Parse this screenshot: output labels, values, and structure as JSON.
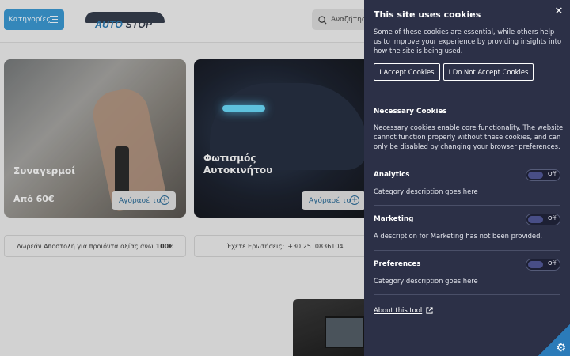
{
  "header": {
    "categories_label": "Κατηγορίες",
    "logo_text_a": "AUTO",
    "logo_text_b": "STOP",
    "search_placeholder": "Αναζήτηση"
  },
  "cards": [
    {
      "title": "Συναγερμοί",
      "price": "Από 60€",
      "button": "Αγόρασέ το"
    },
    {
      "title": "Φωτισμός Αυτοκινήτου",
      "button": "Αγόρασέ το"
    }
  ],
  "info": {
    "shipping_text": "Δωρεάν Αποστολή για προϊόντα αξίας άνω",
    "shipping_amount": "100€",
    "questions_text": "Έχετε Ερωτήσεις;",
    "phone": "+30 2510836104"
  },
  "cookie_panel": {
    "title": "This site uses cookies",
    "intro": "Some of these cookies are essential, while others help us to improve your experience by providing insights into how the site is being used.",
    "accept_label": "I Accept Cookies",
    "reject_label": "I Do Not Accept Cookies",
    "necessary_title": "Necessary Cookies",
    "necessary_desc": "Necessary cookies enable core functionality. The website cannot function properly without these cookies, and can only be disabled by changing your browser preferences.",
    "categories": [
      {
        "title": "Analytics",
        "desc": "Category description goes here",
        "state": "Off"
      },
      {
        "title": "Marketing",
        "desc": "A description for Marketing has not been provided.",
        "state": "Off"
      },
      {
        "title": "Preferences",
        "desc": "Category description goes here",
        "state": "Off"
      }
    ],
    "about_link": "About this tool",
    "close_icon": "close-icon",
    "external_icon": "external-link-icon",
    "settings_icon": "gear-icon"
  },
  "colors": {
    "panel_bg": "#2c3047",
    "accent_blue": "#2f8ec8",
    "toggle_off": "#484e86"
  }
}
